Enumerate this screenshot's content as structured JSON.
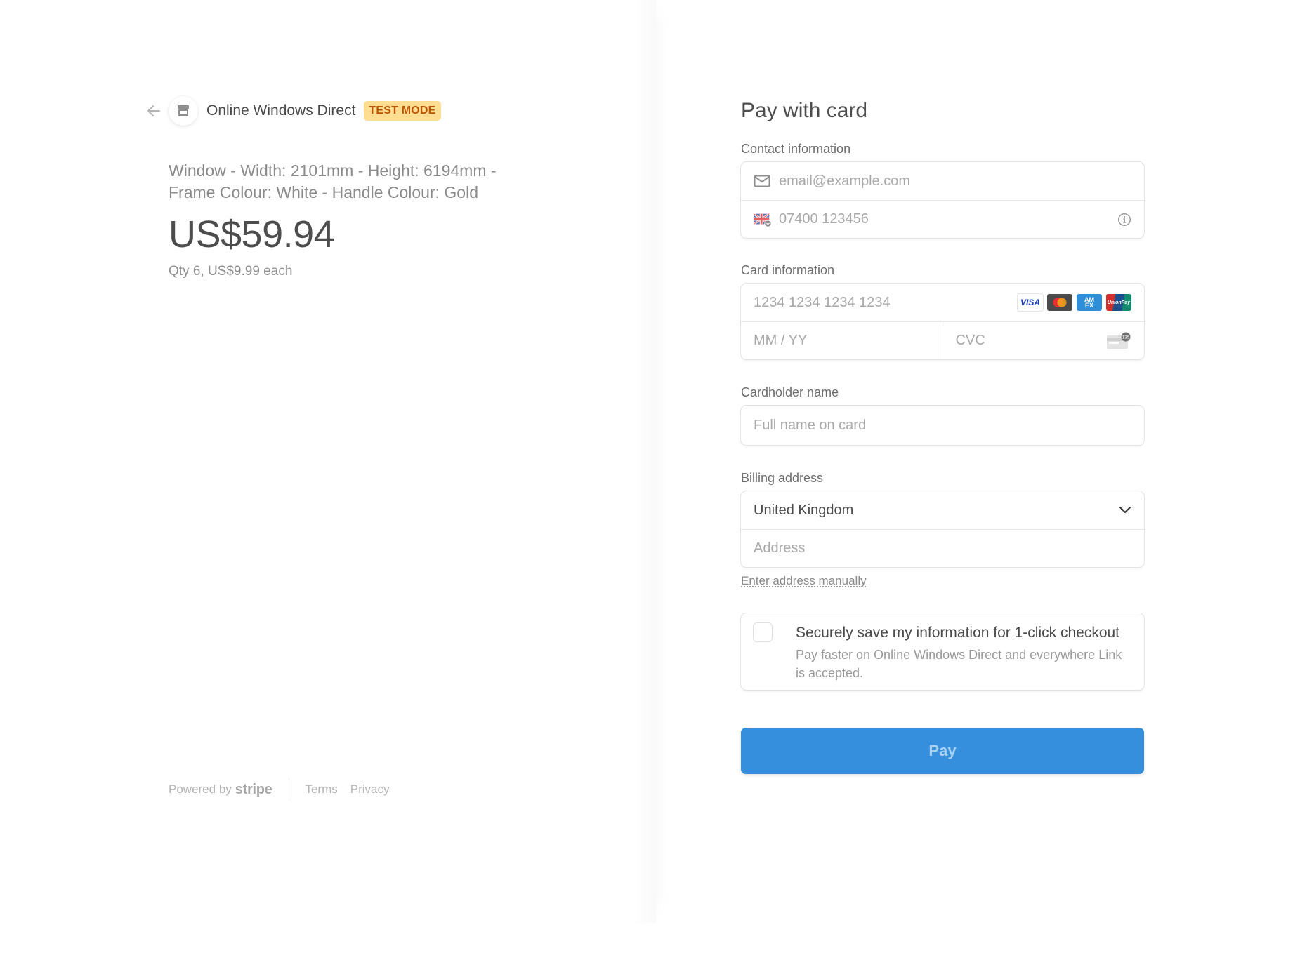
{
  "header": {
    "back_icon": "arrow-left-icon",
    "store_icon": "store-icon",
    "merchant_name": "Online Windows Direct",
    "badge": "TEST MODE"
  },
  "product": {
    "description_line1": "Window - Width: 2101mm - Height: 6194mm -",
    "description_line2": "Frame Colour: White - Handle Colour: Gold",
    "price": "US$59.94",
    "quantity_text": "Qty 6, US$9.99 each"
  },
  "footer": {
    "powered_by": "Powered by",
    "brand": "stripe",
    "links": [
      "Terms",
      "Privacy"
    ]
  },
  "form": {
    "title": "Pay with card",
    "contact": {
      "label": "Contact information",
      "email_placeholder": "email@example.com",
      "email_icon": "mail-icon",
      "phone_placeholder": "07400 123456",
      "phone_flag_icon": "uk-flag-icon",
      "info_icon": "info-icon"
    },
    "card": {
      "label": "Card information",
      "number_placeholder": "1234 1234 1234 1234",
      "brands": [
        "VISA",
        "Mastercard",
        "AMEX",
        "UnionPay"
      ],
      "expiry_placeholder": "MM / YY",
      "cvc_placeholder": "CVC",
      "cvc_icon_text": "135"
    },
    "cardholder": {
      "label": "Cardholder name",
      "placeholder": "Full name on card"
    },
    "billing": {
      "label": "Billing address",
      "country_value": "United Kingdom",
      "address_placeholder": "Address",
      "manual_link": "Enter address manually"
    },
    "save_info": {
      "checked": false,
      "title": "Securely save my information for 1-click checkout",
      "subtitle": "Pay faster on Online Windows Direct and everywhere Link is accepted."
    },
    "pay_button": "Pay"
  },
  "colors": {
    "pay_button": "#358fdd",
    "badge_bg": "#ffde92",
    "badge_text": "#bb5504"
  }
}
